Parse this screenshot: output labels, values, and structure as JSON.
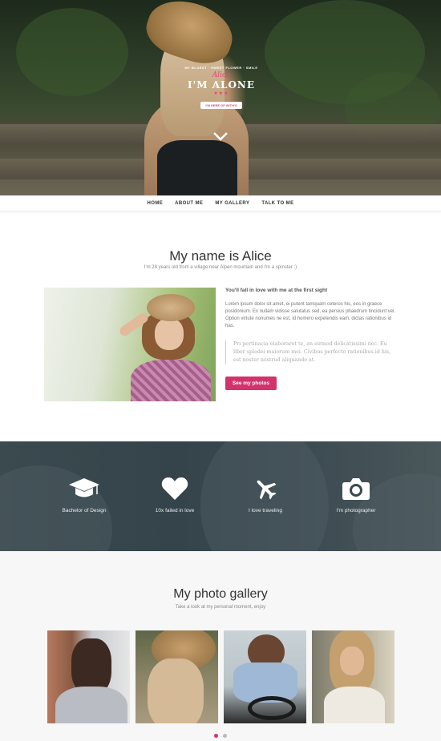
{
  "hero": {
    "badge_small": "MY BLUEST · SWEET FLOWER · SMILE",
    "badge_script": "Alice",
    "badge_title": "I'M ALONE",
    "badge_stars": "★★★",
    "badge_ribbon": "I'M HERE OF WITH'S"
  },
  "nav": {
    "items": [
      "HOME",
      "ABOUT ME",
      "MY GALLERY",
      "TALK TO ME"
    ]
  },
  "about": {
    "title": "My name is Alice",
    "subtitle": "I'm 28 years old from a village near Alpen mountain and I'm a spinster :)",
    "lead": "You'll fall in love with me at the first sight",
    "paragraph": "Lorem ipsum dolor sit amet, ei putent tamquam ceteros his, eos in graece posidonium. Ex nullam vidisse salutatus sed, ea persius phaedrum tincidunt vel. Option virtute nonumes ne est, id homero expetendis eam, dictas rationibus id has.",
    "quote": "Pri pertinacia elaboraret te, an eirmod delicatissimi nec. Eu liber splodei maiorum mei. Civibus perfecto rationibus id his, est noster nostrud aliquando at.",
    "button_label": "See my photos"
  },
  "features": {
    "items": [
      {
        "label": "Bachelor of Design",
        "icon": "graduation-cap-icon"
      },
      {
        "label": "10x failed in love",
        "icon": "heart-icon"
      },
      {
        "label": "I love traveling",
        "icon": "plane-icon"
      },
      {
        "label": "I'm photographer",
        "icon": "camera-icon"
      }
    ]
  },
  "gallery": {
    "title": "My photo gallery",
    "subtitle": "Take a look at my personal moment, enjoy",
    "slides": 2,
    "active_slide": 1
  },
  "colors": {
    "accent": "#d2336b",
    "features_bg": "#3b4a4f",
    "gallery_bg": "#f7f7f7"
  }
}
